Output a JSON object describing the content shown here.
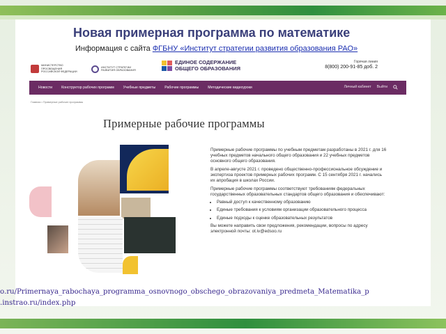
{
  "slide": {
    "title": "Новая примерная программа по математике",
    "subtitle_prefix": "Информация с сайта ",
    "subtitle_link": "ФГБНУ «Институт стратегии развития образования РАО»"
  },
  "site": {
    "org1": "МИНИСТЕРСТВО ПРОСВЕЩЕНИЯ РОССИЙСКОЙ ФЕДЕРАЦИИ",
    "org2": "ИНСТИТУТ СТРАТЕГИИ РАЗВИТИЯ ОБРАЗОВАНИЯ",
    "logo_line1": "ЕДИНОЕ СОДЕРЖАНИЕ",
    "logo_line2": "ОБЩЕГО ОБРАЗОВАНИЯ",
    "hotline_label": "Горячая линия",
    "hotline_phone": "8(800) 200-91-85 доб. 2",
    "nav": [
      "Новости",
      "Конструктор рабочих программ",
      "Учебные предметы",
      "Рабочие программы",
      "Методические видеоуроки"
    ],
    "nav_account": "Личный кабинет",
    "nav_logout": "Выйти",
    "breadcrumb": "Главная  •  Примерные рабочие программы",
    "page_heading": "Примерные рабочие программы",
    "paragraphs": [
      "Примерные рабочие программы по учебным предметам разработаны в 2021 г. для 16 учебных предметов начального общего образования и 22 учебных предметов основного общего образования.",
      "В апреле-августе 2021 г. проведено общественно-профессиональное обсуждение и экспертиза проектов примерных рабочих программ. С 15 сентября 2021 г. начались их апробация в школах России.",
      "Примерные рабочие программы соответствуют требованиям федеральных государственных образовательных стандартов общего образования и обеспечивают:"
    ],
    "bullets": [
      "Равный доступ к качественному образованию",
      "Единые требования к условиям организации образовательного процесса",
      "Единые подходы к оценке образовательных результатов"
    ],
    "closing": "Вы можете направить свои предложения, рекомендации, вопросы по адресу электронной почты: ot.iv@edsoo.ru"
  },
  "urls": {
    "line1": "o.ru/Primernaya_rabochaya_programma_osnovnogo_obschego_obrazovaniya_predmeta_Matematika_p",
    "line2": ".instrao.ru/index.php"
  },
  "colors": {
    "title": "#3a3f7a",
    "nav_bg": "#6b2c63",
    "url": "#3b2b8f",
    "accent_yellow": "#f2c230",
    "accent_pink": "#f2c2c8",
    "accent_blue": "#1e5aa6"
  }
}
